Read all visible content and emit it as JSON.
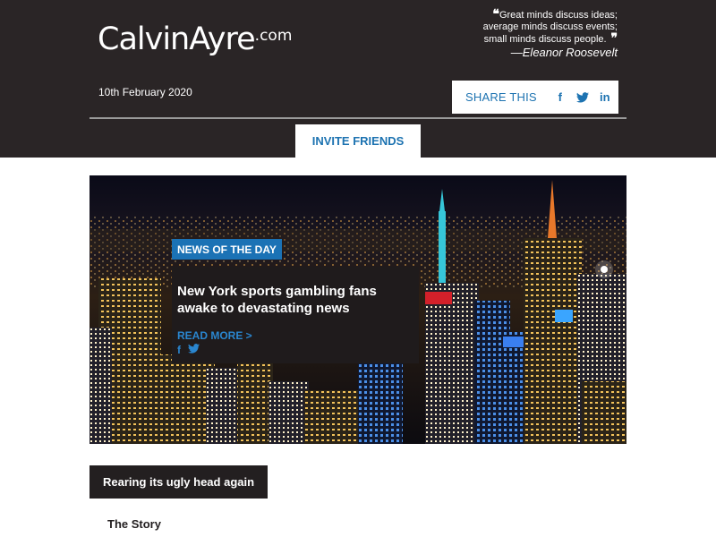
{
  "header": {
    "logo_main": "CalvinAyre",
    "logo_tld": ".com",
    "quote_line1": "Great minds discuss ideas;",
    "quote_line2": "average minds discuss events;",
    "quote_line3": "small minds discuss people.",
    "quote_author": "—Eleanor Roosevelt",
    "date": "10th February 2020",
    "share_label": "SHARE THIS",
    "invite_label": "INVITE FRIENDS",
    "colors": {
      "background": "#2a2526",
      "accent": "#1d73b1"
    }
  },
  "hero": {
    "tag": "NEWS OF THE DAY",
    "title": "New York sports gambling fans awake to devastating news",
    "read_more": "READ MORE >",
    "image_icon": "city-skyline-image"
  },
  "section": {
    "heading": "Rearing its ugly head again",
    "story_label": "The Story"
  },
  "icons": {
    "facebook": "f",
    "twitter": "twitter-icon",
    "linkedin": "in"
  }
}
